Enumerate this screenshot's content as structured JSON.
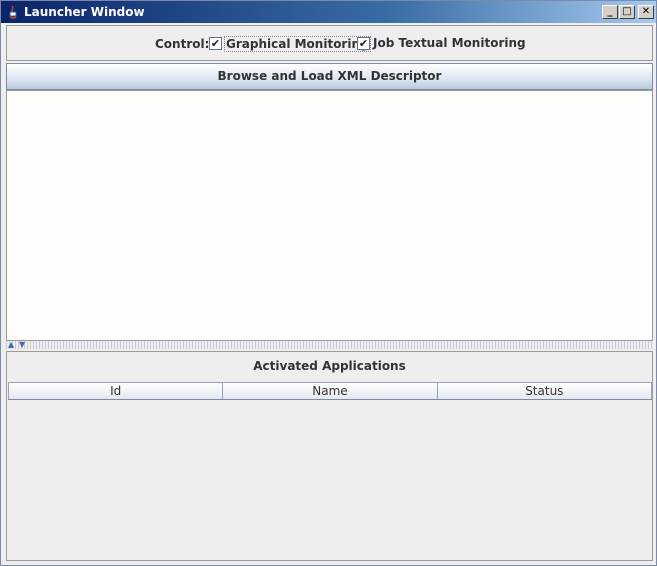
{
  "window": {
    "title": "Launcher Window"
  },
  "control": {
    "label": "Control:",
    "graphical": {
      "label": "Graphical Monitoring",
      "checked": true
    },
    "textual": {
      "label": "Job Textual Monitoring",
      "checked": true
    }
  },
  "browse": {
    "label": "Browse and Load XML Descriptor"
  },
  "applications": {
    "title": "Activated Applications",
    "columns": [
      "Id",
      "Name",
      "Status"
    ],
    "rows": []
  }
}
